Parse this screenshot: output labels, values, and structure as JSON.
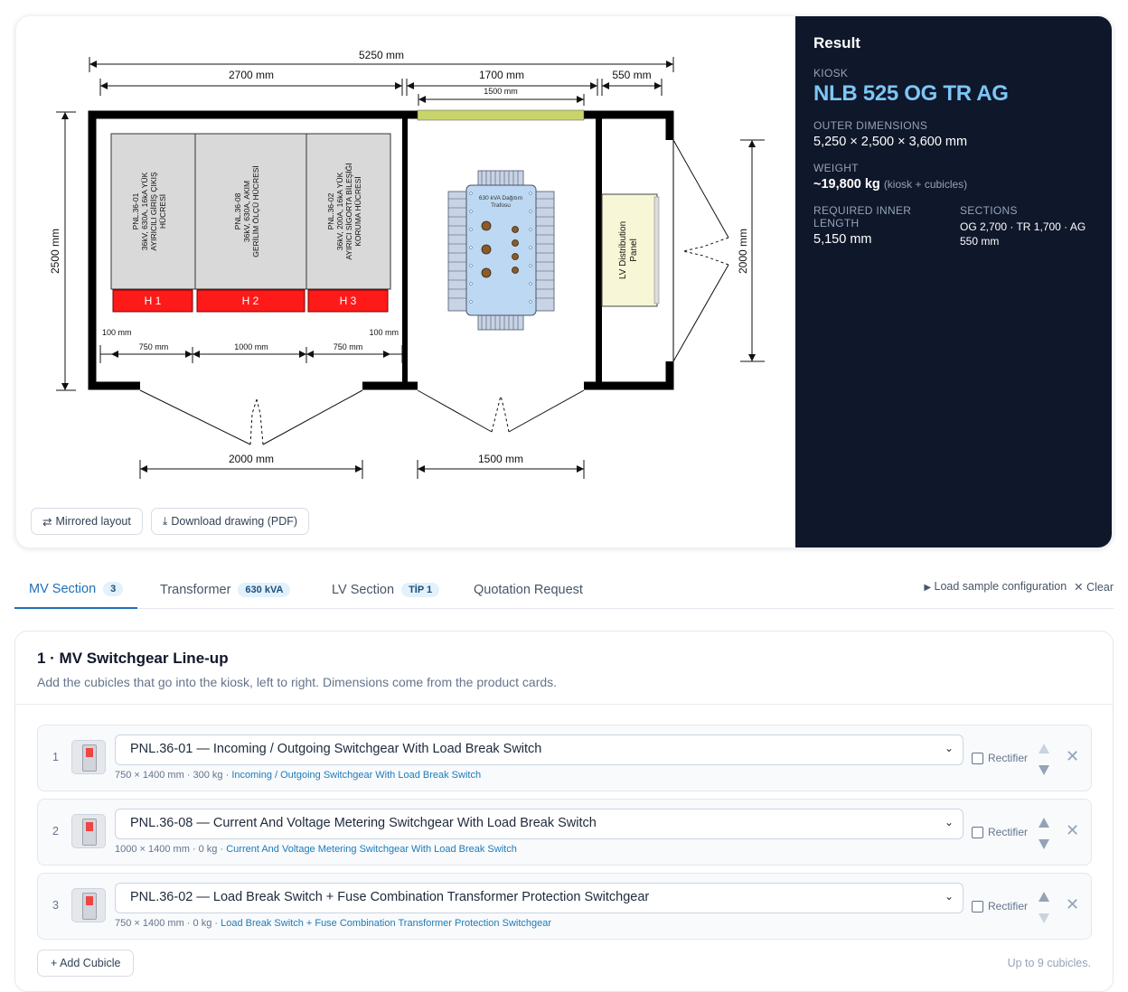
{
  "drawing": {
    "dims": {
      "total_width": "5250 mm",
      "mv_width": "2700 mm",
      "tr_width": "1700 mm",
      "tr_inner": "1500 mm",
      "lv_width": "550 mm",
      "depth": "2500 mm",
      "lv_door": "2000 mm",
      "margin_left": "100 mm",
      "margin_right": "100 mm",
      "cub1": "750 mm",
      "cub2": "1000 mm",
      "cub3": "750 mm",
      "mv_door": "2000 mm",
      "tr_door": "1500 mm"
    },
    "cubicles": [
      {
        "code": "H 1",
        "line1": "PNL.36-01",
        "line2": "36kV, 630A, 16kA YÜK",
        "line3": "AYIRICILI GİRİŞ ÇIKIŞ",
        "line4": "HÜCRESİ"
      },
      {
        "code": "H 2",
        "line1": "PNL.36-08",
        "line2": "36kV, 630A, AKIM",
        "line3": "GERİLİM ÖLÇÜ HÜCRESİ",
        "line4": ""
      },
      {
        "code": "H 3",
        "line1": "PNL.36-02",
        "line2": "36kV, 200A, 16kA YÜK",
        "line3": "AYIRICI SİGORTA BİLEŞİĞİ",
        "line4": "KORUMA HÜCRESİ"
      }
    ],
    "transformer_label_1": "630 kVA Dağıtım",
    "transformer_label_2": "Trafosu",
    "lv_panel_1": "LV Distribution",
    "lv_panel_2": "Panel",
    "buttons": {
      "mirror_icon": "⇄",
      "mirror": "Mirrored layout",
      "download_icon": "⤓",
      "download": "Download drawing (PDF)"
    }
  },
  "result": {
    "title": "Result",
    "kiosk_label": "KIOSK",
    "kiosk": "NLB 525 OG TR AG",
    "outer_label": "OUTER DIMENSIONS",
    "outer": "5,250 × 2,500 × 3,600 mm",
    "weight_label": "WEIGHT",
    "weight": "~19,800 kg",
    "weight_sub": "(kiosk + cubicles)",
    "inner_label": "REQUIRED INNER LENGTH",
    "inner": "5,150 mm",
    "sections_label": "SECTIONS",
    "sections": "OG 2,700 · TR 1,700 · AG 550 mm"
  },
  "tabs": [
    {
      "label": "MV Section",
      "badge": "3"
    },
    {
      "label": "Transformer",
      "badge": "630 kVA"
    },
    {
      "label": "LV Section",
      "badge": "TİP 1"
    },
    {
      "label": "Quotation Request",
      "badge": ""
    }
  ],
  "actions": {
    "sample_icon": "▶",
    "sample": "Load sample configuration",
    "clear_icon": "✕",
    "clear": "Clear"
  },
  "section": {
    "title": "1 · MV Switchgear Line-up",
    "desc": "Add the cubicles that go into the kiosk, left to right. Dimensions come from the product cards.",
    "rows": [
      {
        "num": "1",
        "value": "PNL.36-01 — Incoming / Outgoing Switchgear With Load Break Switch",
        "meta": "750 × 1400 mm · 300 kg ·",
        "link": "Incoming / Outgoing Switchgear With Load Break Switch",
        "rect": "Rectifier"
      },
      {
        "num": "2",
        "value": "PNL.36-08 — Current And Voltage Metering Switchgear With Load Break Switch",
        "meta": "1000 × 1400 mm · 0 kg ·",
        "link": "Current And Voltage Metering Switchgear With Load Break Switch",
        "rect": "Rectifier"
      },
      {
        "num": "3",
        "value": "PNL.36-02 — Load Break Switch + Fuse Combination Transformer Protection Switchgear",
        "meta": "750 × 1400 mm · 0 kg ·",
        "link": "Load Break Switch + Fuse Combination Transformer Protection Switchgear",
        "rect": "Rectifier"
      }
    ],
    "add": "+ Add Cubicle",
    "limit": "Up to 9 cubicles.",
    "select_chevron": "⌄",
    "delete_icon": "✕"
  }
}
